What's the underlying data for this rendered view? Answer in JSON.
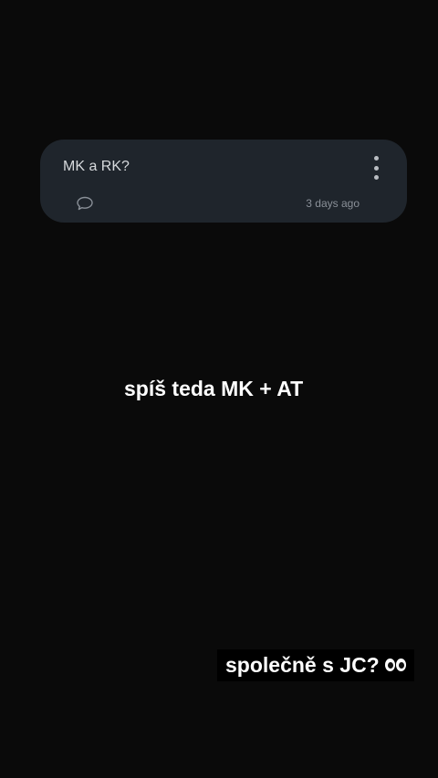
{
  "card": {
    "text": "MK a RK?",
    "time": "3 days ago",
    "menu_icon": "more-vertical-icon",
    "comment_icon": "comment-bubble-icon"
  },
  "stickers": {
    "first": "spíš teda MK + AT",
    "second": "společně s JC?",
    "second_emoji": "eyes-emoji"
  },
  "colors": {
    "background": "#0a0a0a",
    "card": "#1f252c",
    "text": "#ffffff"
  }
}
